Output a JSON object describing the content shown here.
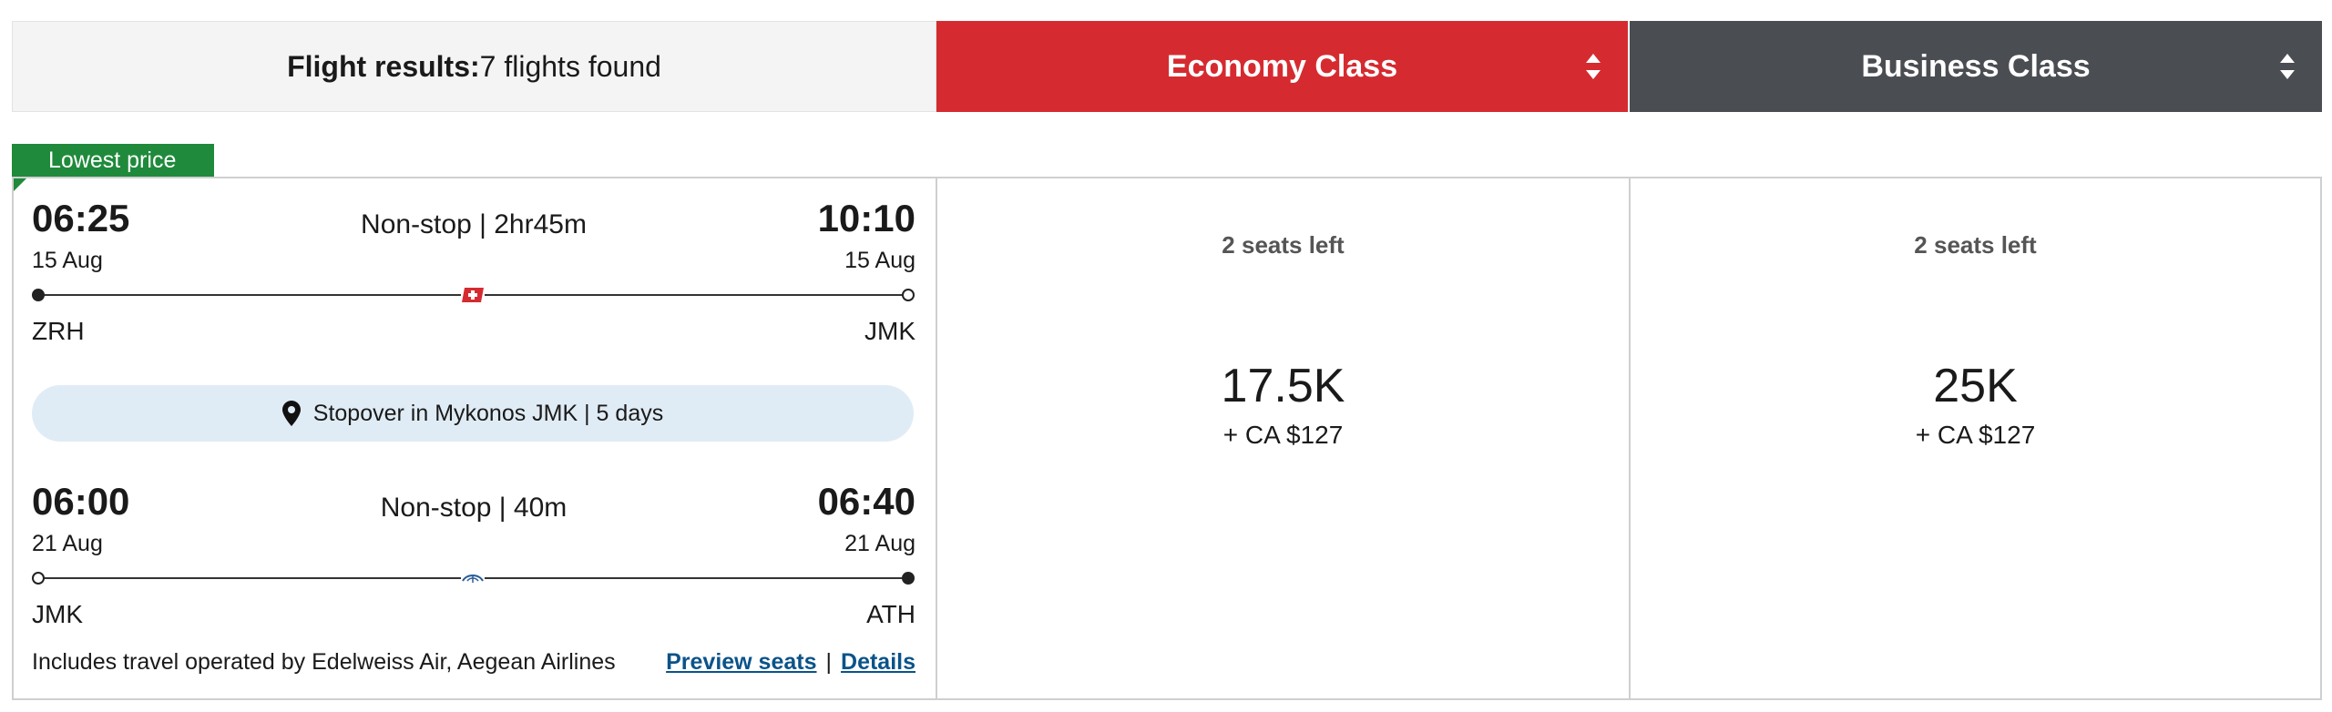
{
  "header": {
    "results_label": "Flight results:",
    "results_count": "7 flights found",
    "economy_label": "Economy Class",
    "business_label": "Business Class",
    "economy_color": "#d52b30",
    "business_color": "#4a4d52"
  },
  "badge": {
    "label": "Lowest price",
    "color": "#1f8a3b"
  },
  "segment1": {
    "depart_time": "06:25",
    "depart_date": "15 Aug",
    "depart_code": "ZRH",
    "arrive_time": "10:10",
    "arrive_date": "15 Aug",
    "arrive_code": "JMK",
    "duration": "Non-stop | 2hr45m",
    "airline_icon": "swiss-cross-icon"
  },
  "stopover": {
    "text": "Stopover in Mykonos JMK | 5 days",
    "icon": "map-pin-icon"
  },
  "segment2": {
    "depart_time": "06:00",
    "depart_date": "21 Aug",
    "depart_code": "JMK",
    "arrive_time": "06:40",
    "arrive_date": "21 Aug",
    "arrive_code": "ATH",
    "duration": "Non-stop | 40m",
    "airline_icon": "aegean-bird-icon"
  },
  "operated_by": "Includes travel operated by Edelweiss Air, Aegean Airlines",
  "links": {
    "preview": "Preview seats",
    "separator": "|",
    "details": "Details"
  },
  "economy": {
    "seats": "2 seats left",
    "points": "17.5K",
    "tax": "+ CA $127"
  },
  "business": {
    "seats": "2 seats left",
    "points": "25K",
    "tax": "+ CA $127"
  }
}
